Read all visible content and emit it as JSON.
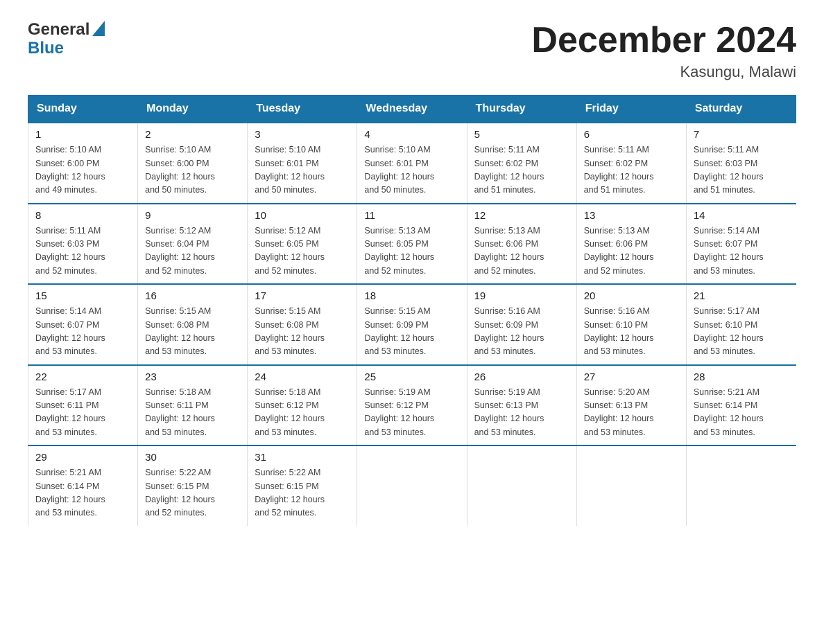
{
  "header": {
    "logo_general": "General",
    "logo_blue": "Blue",
    "month_title": "December 2024",
    "location": "Kasungu, Malawi"
  },
  "days_of_week": [
    "Sunday",
    "Monday",
    "Tuesday",
    "Wednesday",
    "Thursday",
    "Friday",
    "Saturday"
  ],
  "weeks": [
    [
      {
        "day": "1",
        "sunrise": "5:10 AM",
        "sunset": "6:00 PM",
        "daylight": "12 hours and 49 minutes."
      },
      {
        "day": "2",
        "sunrise": "5:10 AM",
        "sunset": "6:00 PM",
        "daylight": "12 hours and 50 minutes."
      },
      {
        "day": "3",
        "sunrise": "5:10 AM",
        "sunset": "6:01 PM",
        "daylight": "12 hours and 50 minutes."
      },
      {
        "day": "4",
        "sunrise": "5:10 AM",
        "sunset": "6:01 PM",
        "daylight": "12 hours and 50 minutes."
      },
      {
        "day": "5",
        "sunrise": "5:11 AM",
        "sunset": "6:02 PM",
        "daylight": "12 hours and 51 minutes."
      },
      {
        "day": "6",
        "sunrise": "5:11 AM",
        "sunset": "6:02 PM",
        "daylight": "12 hours and 51 minutes."
      },
      {
        "day": "7",
        "sunrise": "5:11 AM",
        "sunset": "6:03 PM",
        "daylight": "12 hours and 51 minutes."
      }
    ],
    [
      {
        "day": "8",
        "sunrise": "5:11 AM",
        "sunset": "6:03 PM",
        "daylight": "12 hours and 52 minutes."
      },
      {
        "day": "9",
        "sunrise": "5:12 AM",
        "sunset": "6:04 PM",
        "daylight": "12 hours and 52 minutes."
      },
      {
        "day": "10",
        "sunrise": "5:12 AM",
        "sunset": "6:05 PM",
        "daylight": "12 hours and 52 minutes."
      },
      {
        "day": "11",
        "sunrise": "5:13 AM",
        "sunset": "6:05 PM",
        "daylight": "12 hours and 52 minutes."
      },
      {
        "day": "12",
        "sunrise": "5:13 AM",
        "sunset": "6:06 PM",
        "daylight": "12 hours and 52 minutes."
      },
      {
        "day": "13",
        "sunrise": "5:13 AM",
        "sunset": "6:06 PM",
        "daylight": "12 hours and 52 minutes."
      },
      {
        "day": "14",
        "sunrise": "5:14 AM",
        "sunset": "6:07 PM",
        "daylight": "12 hours and 53 minutes."
      }
    ],
    [
      {
        "day": "15",
        "sunrise": "5:14 AM",
        "sunset": "6:07 PM",
        "daylight": "12 hours and 53 minutes."
      },
      {
        "day": "16",
        "sunrise": "5:15 AM",
        "sunset": "6:08 PM",
        "daylight": "12 hours and 53 minutes."
      },
      {
        "day": "17",
        "sunrise": "5:15 AM",
        "sunset": "6:08 PM",
        "daylight": "12 hours and 53 minutes."
      },
      {
        "day": "18",
        "sunrise": "5:15 AM",
        "sunset": "6:09 PM",
        "daylight": "12 hours and 53 minutes."
      },
      {
        "day": "19",
        "sunrise": "5:16 AM",
        "sunset": "6:09 PM",
        "daylight": "12 hours and 53 minutes."
      },
      {
        "day": "20",
        "sunrise": "5:16 AM",
        "sunset": "6:10 PM",
        "daylight": "12 hours and 53 minutes."
      },
      {
        "day": "21",
        "sunrise": "5:17 AM",
        "sunset": "6:10 PM",
        "daylight": "12 hours and 53 minutes."
      }
    ],
    [
      {
        "day": "22",
        "sunrise": "5:17 AM",
        "sunset": "6:11 PM",
        "daylight": "12 hours and 53 minutes."
      },
      {
        "day": "23",
        "sunrise": "5:18 AM",
        "sunset": "6:11 PM",
        "daylight": "12 hours and 53 minutes."
      },
      {
        "day": "24",
        "sunrise": "5:18 AM",
        "sunset": "6:12 PM",
        "daylight": "12 hours and 53 minutes."
      },
      {
        "day": "25",
        "sunrise": "5:19 AM",
        "sunset": "6:12 PM",
        "daylight": "12 hours and 53 minutes."
      },
      {
        "day": "26",
        "sunrise": "5:19 AM",
        "sunset": "6:13 PM",
        "daylight": "12 hours and 53 minutes."
      },
      {
        "day": "27",
        "sunrise": "5:20 AM",
        "sunset": "6:13 PM",
        "daylight": "12 hours and 53 minutes."
      },
      {
        "day": "28",
        "sunrise": "5:21 AM",
        "sunset": "6:14 PM",
        "daylight": "12 hours and 53 minutes."
      }
    ],
    [
      {
        "day": "29",
        "sunrise": "5:21 AM",
        "sunset": "6:14 PM",
        "daylight": "12 hours and 53 minutes."
      },
      {
        "day": "30",
        "sunrise": "5:22 AM",
        "sunset": "6:15 PM",
        "daylight": "12 hours and 52 minutes."
      },
      {
        "day": "31",
        "sunrise": "5:22 AM",
        "sunset": "6:15 PM",
        "daylight": "12 hours and 52 minutes."
      },
      null,
      null,
      null,
      null
    ]
  ],
  "labels": {
    "sunrise": "Sunrise:",
    "sunset": "Sunset:",
    "daylight": "Daylight:"
  }
}
